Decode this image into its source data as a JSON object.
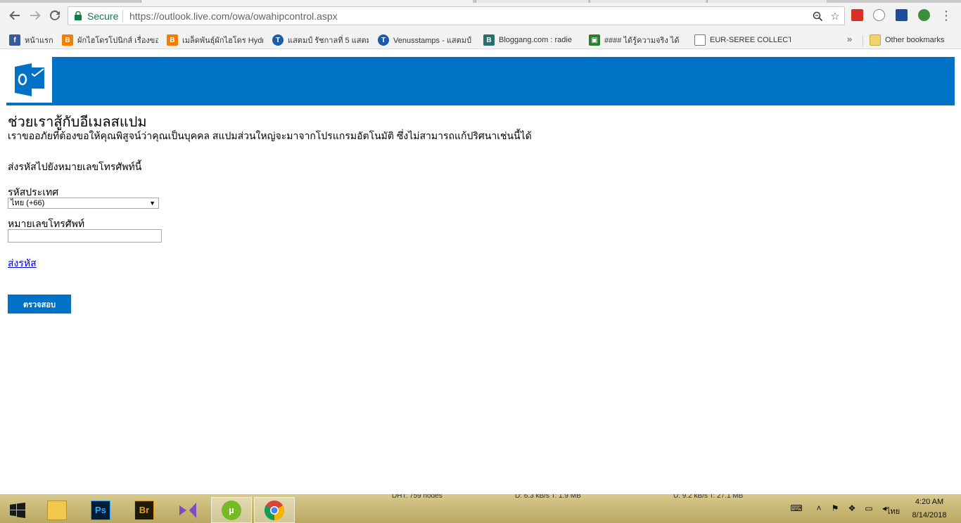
{
  "browser": {
    "secure_label": "Secure",
    "url": "https://outlook.live.com/owa/owahipcontrol.aspx",
    "bookmarks": [
      {
        "label": "หน้าแรก",
        "icon": "facebook-icon",
        "color": "#3b5998"
      },
      {
        "label": "ผักไฮโดรโปนิกส์ เรื่องของ",
        "icon": "blogger-icon",
        "color": "#f57d00"
      },
      {
        "label": "เมล็ดพันธุ์ผักไฮโดร Hydr",
        "icon": "blogger-icon",
        "color": "#f57d00"
      },
      {
        "label": "แสตมป์ รัชกาลที่ 5 แสตม",
        "icon": "t-circle-icon",
        "color": "#1e5aa8"
      },
      {
        "label": "Venusstamps - แสตมป์",
        "icon": "t-circle-icon",
        "color": "#1e5aa8"
      },
      {
        "label": "Bloggang.com : radie",
        "icon": "bloggang-icon",
        "color": "#2a6e6e"
      },
      {
        "label": "#### ได้รู้ความจริง ได้",
        "icon": "image-icon",
        "color": "#2f7d32"
      },
      {
        "label": "EUR-SEREE COLLECTI",
        "icon": "page-icon",
        "color": "#777777"
      }
    ],
    "more_label": "»",
    "other_bookmarks_label": "Other bookmarks"
  },
  "page": {
    "title": "ช่วยเราสู้กับอีเมลสแปม",
    "description": "เราขออภัยที่ต้องขอให้คุณพิสูจน์ว่าคุณเป็นบุคคล สแปมส่วนใหญ่จะมาจากโปรแกรมอัตโนมัติ ซึ่งไม่สามารถแก้ปริศนาเช่นนี้ได้",
    "send_note": "ส่งรหัสไปยังหมายเลขโทรศัพท์นี้",
    "country_label": "รหัสประเทศ",
    "country_value": "ไทย (+66)",
    "phone_label": "หมายเลขโทรศัพท์",
    "phone_value": "",
    "send_code_link": "ส่งรหัส",
    "verify_button": "ตรวจสอบ",
    "brand_color": "#0072c6"
  },
  "taskbar": {
    "overlay_text": [
      "DHT: 759 nodes",
      "D: 6.3 kB/s T: 1.9 MB",
      "U: 9.2 kB/s T: 27.1 MB"
    ],
    "apps": [
      {
        "name": "file-explorer-icon"
      },
      {
        "name": "photoshop-icon",
        "label": "Ps"
      },
      {
        "name": "bridge-icon",
        "label": "Br"
      },
      {
        "name": "visual-studio-icon"
      },
      {
        "name": "utorrent-icon"
      },
      {
        "name": "chrome-icon"
      }
    ],
    "language": "ไทย",
    "time": "4:20 AM",
    "date": "8/14/2018"
  }
}
